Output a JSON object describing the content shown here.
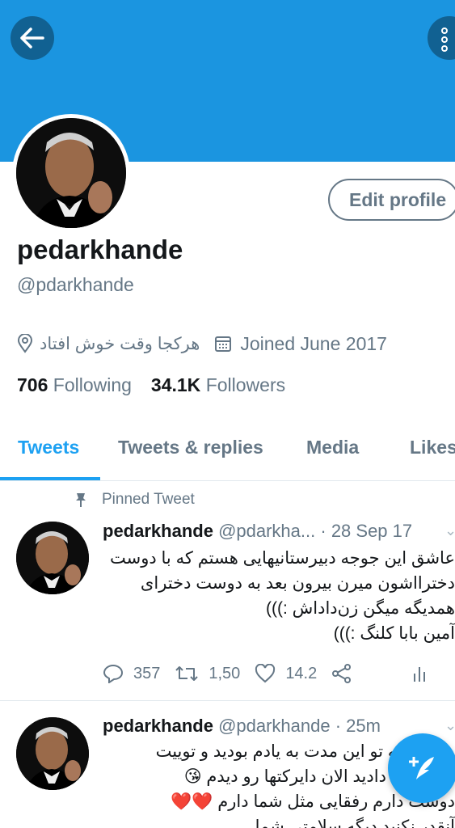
{
  "header": {
    "banner_color": "#1b95e0",
    "back_icon": "arrow-left-icon",
    "more_icon": "more-vertical-icon"
  },
  "profile": {
    "edit_profile_label": "Edit profile",
    "display_name": "pedarkhande",
    "handle": "@pdarkhande",
    "location": "هرکجا وقت خوش افتاد",
    "joined": "Joined June 2017",
    "following_count": "706",
    "following_label": "Following",
    "followers_count": "34.1K",
    "followers_label": "Followers"
  },
  "tabs": [
    {
      "label": "Tweets",
      "active": true
    },
    {
      "label": "Tweets & replies",
      "active": false
    },
    {
      "label": "Media",
      "active": false
    },
    {
      "label": "Likes",
      "active": false
    }
  ],
  "pinned_label": "Pinned Tweet",
  "tweets": [
    {
      "name": "pedarkhande",
      "handle": "@pdarkha...",
      "time": "· 28 Sep 17",
      "lines": [
        "عاشق این جوجه دبیرستانیهایی هستم که با دوست",
        "دخترااشون میرن بیرون بعد به دوست دخترای",
        "همدیگه میگن زن‌داداش :)))",
        "آمین بابا کلنگ :)))"
      ],
      "replies": "357",
      "retweets": "1,50",
      "likes": "14.2"
    },
    {
      "name": "pedarkhande",
      "handle": "@pdarkhande",
      "time": "· 25m",
      "lines": [
        "ممنون که تو این مدت به یادم بودید و توییت",
        "و دایرکت دادید الان دایرکتها رو دیدم 😘",
        "دوست دارم رفقایی مثل شما دارم ❤️❤️",
        "آنقدر نکنید دیگه سلامتی شما"
      ]
    }
  ],
  "colors": {
    "accent": "#1da1f2",
    "muted": "#657786",
    "text": "#14171a"
  },
  "fab_icon": "compose-tweet-icon"
}
